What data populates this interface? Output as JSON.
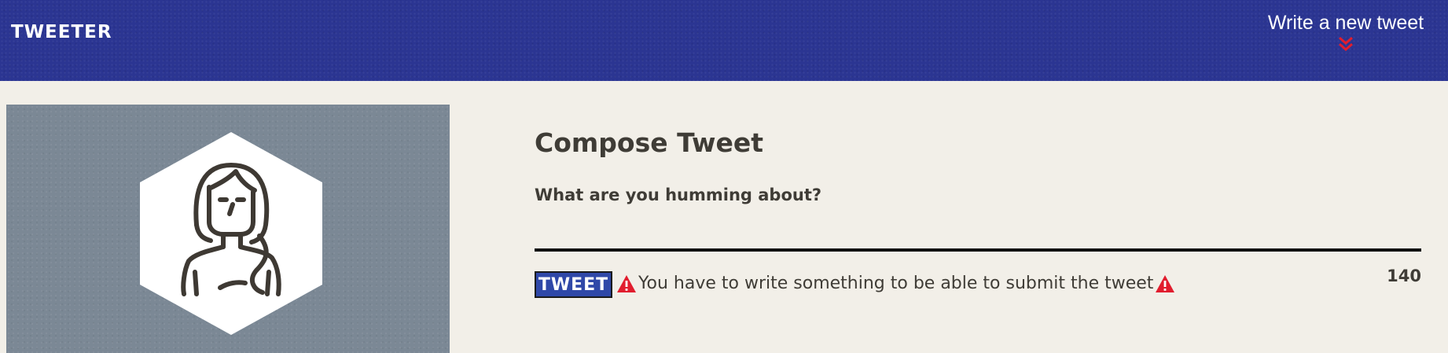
{
  "nav": {
    "logo": "TWEETER",
    "write_new_tweet": "Write a new tweet",
    "chevron_icon": "double-chevron-down-icon"
  },
  "profile": {
    "avatar_icon": "woman-avatar-icon"
  },
  "compose": {
    "title": "Compose Tweet",
    "label": "What are you humming about?",
    "input_value": "",
    "button_label": "TWEET",
    "error_message": "You have to write something to be able to submit the tweet",
    "warning_icon": "warning-icon",
    "counter": "140"
  },
  "colors": {
    "nav_bg": "#2b3592",
    "page_bg": "#f2efe8",
    "profile_bg": "#7b8895",
    "accent_red": "#e11d2e",
    "button_bg": "#2f48a8",
    "text": "#3f3c36"
  }
}
